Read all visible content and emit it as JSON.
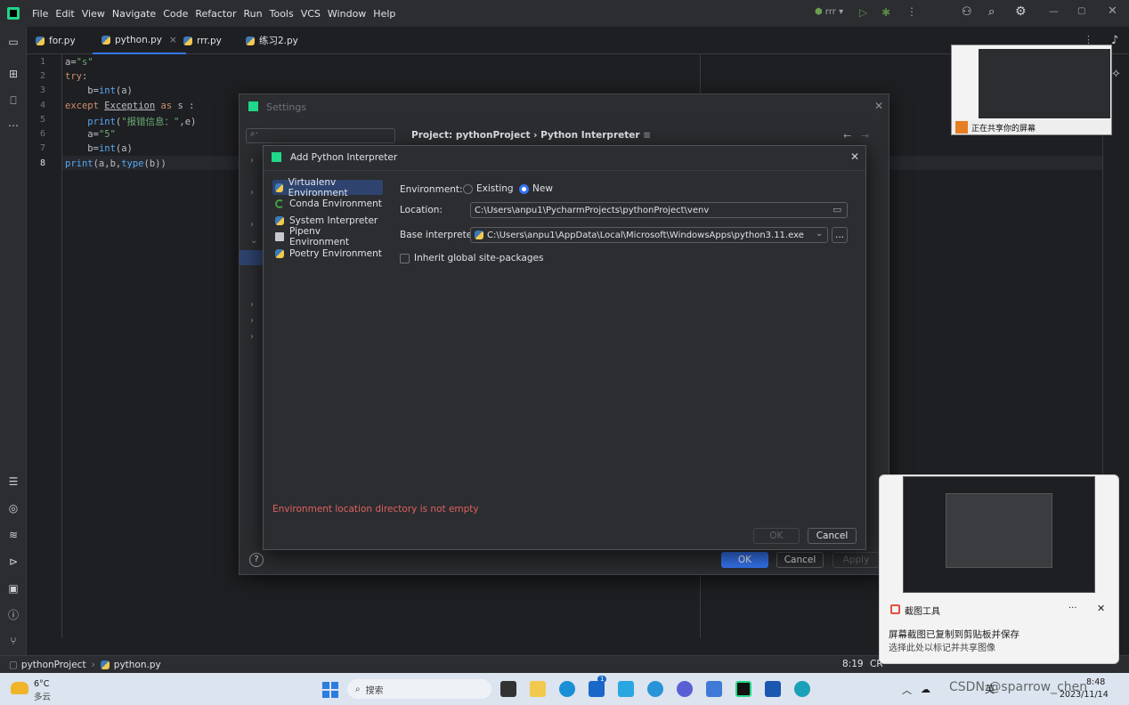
{
  "menu": [
    "File",
    "Edit",
    "View",
    "Navigate",
    "Code",
    "Refactor",
    "Run",
    "Tools",
    "VCS",
    "Window",
    "Help"
  ],
  "run_config": "rrr",
  "tabs": [
    {
      "label": "for.py"
    },
    {
      "label": "python.py"
    },
    {
      "label": "rrr.py"
    },
    {
      "label": "练习2.py"
    }
  ],
  "line_numbers": [
    "1",
    "2",
    "3",
    "4",
    "5",
    "6",
    "7",
    "8"
  ],
  "settings": {
    "title": "Settings",
    "breadcrumb_project": "Project: pythonProject",
    "breadcrumb_sep": "›",
    "breadcrumb_page": "Python Interpreter",
    "ok": "OK",
    "cancel": "Cancel",
    "apply": "Apply"
  },
  "dialog": {
    "title": "Add Python Interpreter",
    "env_types": [
      "Virtualenv Environment",
      "Conda Environment",
      "System Interpreter",
      "Pipenv Environment",
      "Poetry Environment"
    ],
    "environment_label": "Environment:",
    "existing": "Existing",
    "new": "New",
    "location_label": "Location:",
    "location_value": "C:\\Users\\anpu1\\PycharmProjects\\pythonProject\\venv",
    "base_label": "Base interpreter:",
    "base_value": "C:\\Users\\anpu1\\AppData\\Local\\Microsoft\\WindowsApps\\python3.11.exe",
    "browse": "...",
    "inherit_label": "Inherit global site-packages",
    "error": "Environment location directory is not empty",
    "ok": "OK",
    "cancel": "Cancel"
  },
  "statusbar": {
    "project": "pythonProject",
    "file": "python.py",
    "position": "8:19",
    "crlf": "CR"
  },
  "share_caption": "正在共享你的屏幕",
  "notification": {
    "app": "截图工具",
    "title": "屏幕截图已复制到剪贴板并保存",
    "body": "选择此处以标记并共享图像",
    "more": "···"
  },
  "taskbar": {
    "temp": "6°C",
    "weather": "多云",
    "search": "搜索",
    "badge": "1",
    "time": "8:48",
    "date": "2023/11/14",
    "lang": "英",
    "watermark": "CSDN @sparrow_chen"
  },
  "colors": {
    "accent": "#3574f0",
    "error": "#e06060",
    "bg": "#1e1f22",
    "panel": "#2b2d30"
  }
}
